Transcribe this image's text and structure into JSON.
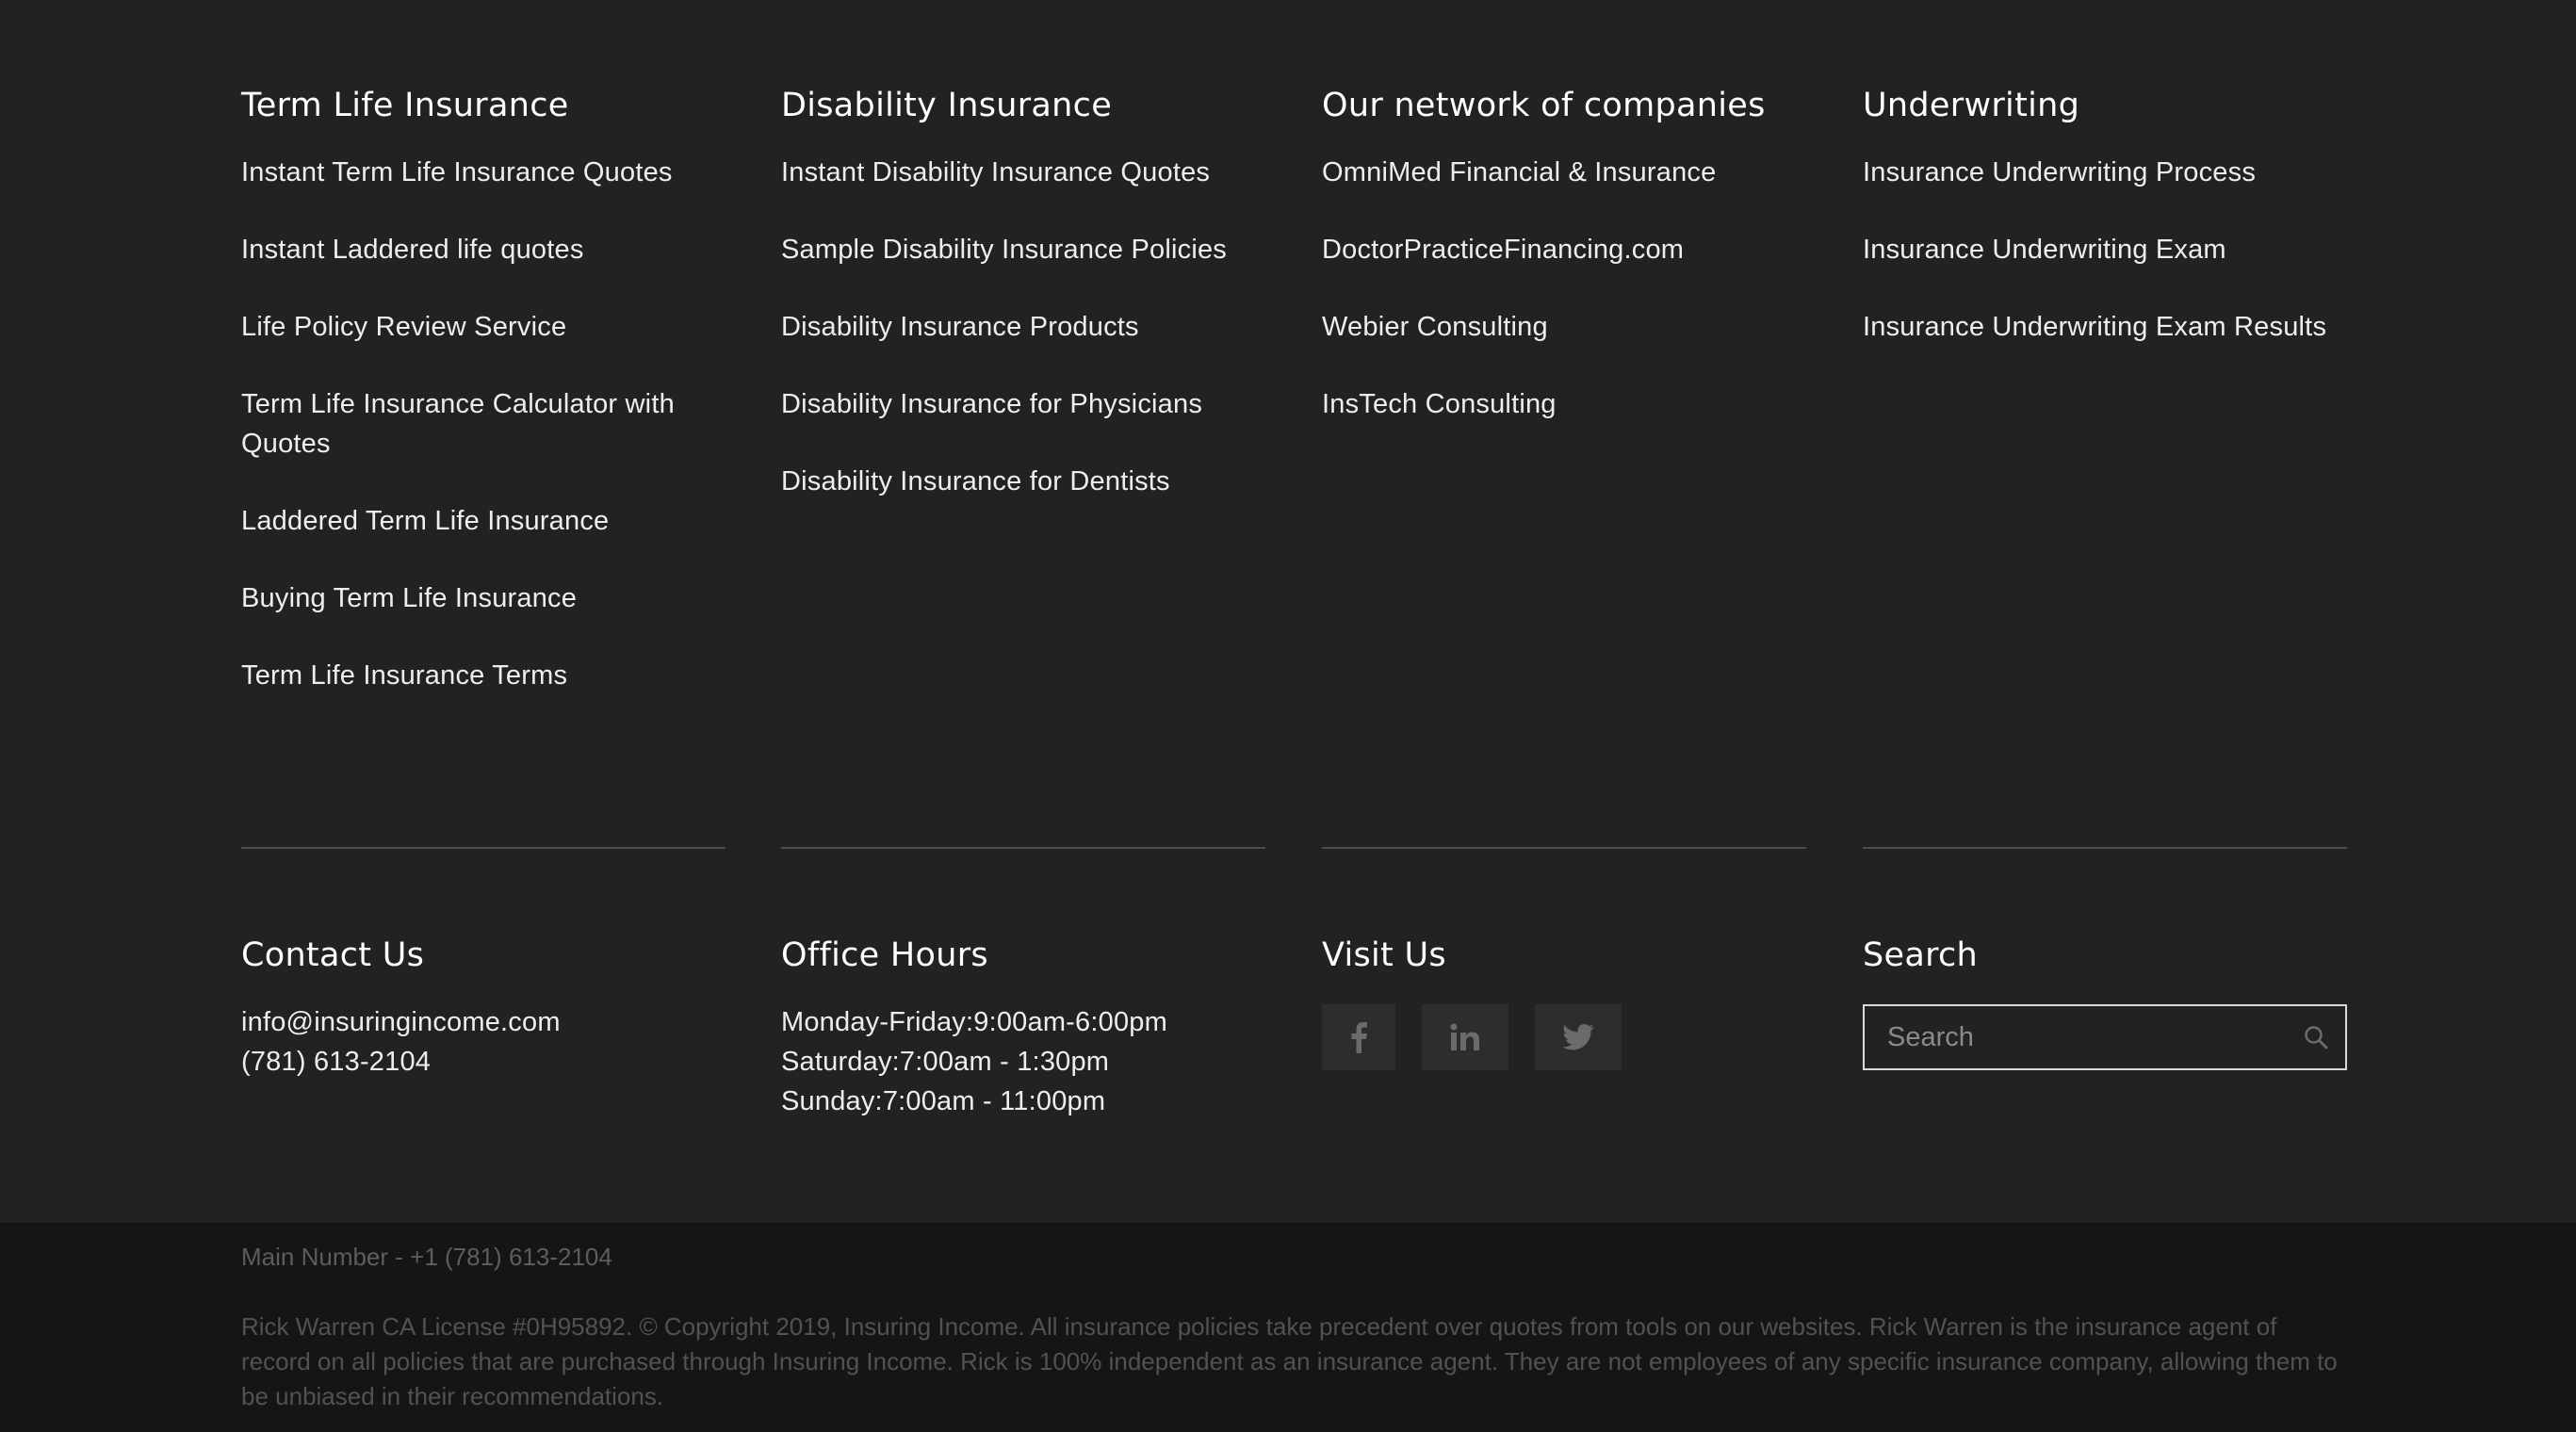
{
  "columns_top": [
    {
      "heading": "Term Life Insurance",
      "links": [
        "Instant Term Life Insurance Quotes",
        "Instant Laddered life quotes",
        "Life Policy Review Service",
        "Term Life Insurance Calculator with Quotes",
        "Laddered Term Life Insurance",
        "Buying Term Life Insurance",
        "Term Life Insurance Terms"
      ]
    },
    {
      "heading": "Disability Insurance",
      "links": [
        "Instant Disability Insurance Quotes",
        "Sample Disability Insurance Policies",
        "Disability Insurance Products",
        "Disability Insurance for Physicians",
        "Disability Insurance for Dentists"
      ]
    },
    {
      "heading": "Our network of companies",
      "links": [
        "OmniMed Financial & Insurance",
        "DoctorPracticeFinancing.com",
        "Webier Consulting",
        "InsTech Consulting"
      ]
    },
    {
      "heading": "Underwriting",
      "links": [
        "Insurance Underwriting Process",
        "Insurance Underwriting Exam",
        "Insurance Underwriting Exam Results"
      ]
    }
  ],
  "contact": {
    "heading": "Contact Us",
    "email": "info@insuringincome.com",
    "phone": "(781) 613-2104"
  },
  "office_hours": {
    "heading": "Office Hours",
    "lines": [
      "Monday-Friday:9:00am-6:00pm",
      "Saturday:7:00am - 1:30pm",
      "Sunday:7:00am - 11:00pm"
    ]
  },
  "visit": {
    "heading": "Visit Us",
    "icons": [
      "facebook-icon",
      "linkedin-icon",
      "twitter-icon"
    ]
  },
  "search": {
    "heading": "Search",
    "placeholder": "Search",
    "icon": "search-icon"
  },
  "bottom": {
    "main_number": "Main Number - +1 (781) 613-2104",
    "legal": "Rick Warren CA License #0H95892. © Copyright 2019, Insuring Income. All insurance policies take precedent over quotes from tools on our websites. Rick Warren is the insurance agent of record on all policies that are purchased through Insuring Income. Rick is 100% independent as an insurance agent. They are not employees of any specific insurance company, allowing them to be unbiased in their recommendations."
  },
  "colors": {
    "footer_bg": "#222223",
    "bottom_bar_bg": "#151516",
    "divider": "#4d4d4d",
    "social_button_bg": "#2c2d2e",
    "social_icon": "#6b6b6b",
    "legal_text": "#525252"
  }
}
